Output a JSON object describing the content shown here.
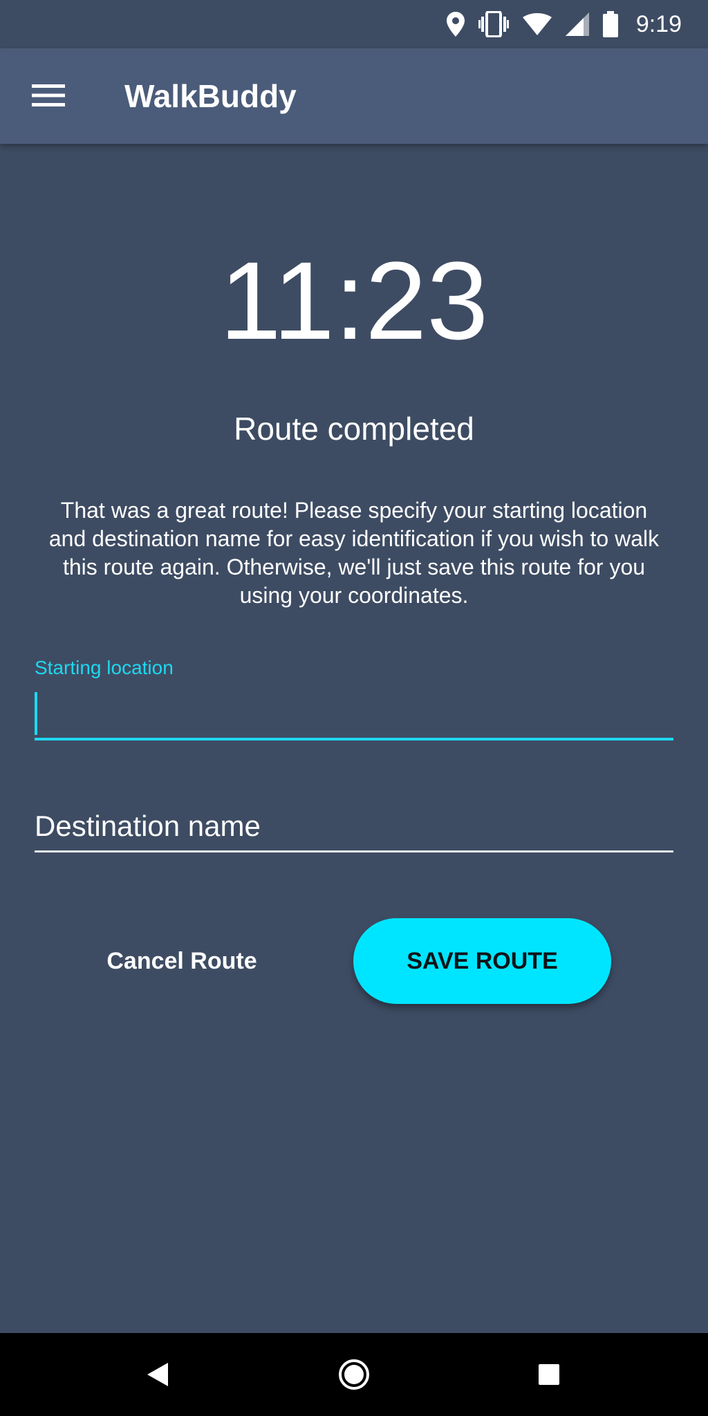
{
  "status_bar": {
    "time": "9:19",
    "icons": [
      "location-icon",
      "vibrate-icon",
      "wifi-icon",
      "signal-icon",
      "battery-icon"
    ]
  },
  "app_bar": {
    "title": "WalkBuddy",
    "menu_icon": "hamburger-menu-icon"
  },
  "main": {
    "elapsed_time": "11:23",
    "heading": "Route completed",
    "description": "That was a great route! Please specify your starting location and destination name for easy identification if you wish to walk this route again. Otherwise, we'll just save this route for you using your coordinates."
  },
  "form": {
    "starting_location": {
      "label": "Starting location",
      "value": ""
    },
    "destination": {
      "placeholder": "Destination name",
      "value": ""
    }
  },
  "actions": {
    "cancel_label": "Cancel Route",
    "save_label": "SAVE ROUTE"
  },
  "nav_bar": {
    "icons": [
      "back-icon",
      "home-icon",
      "recents-icon"
    ]
  },
  "colors": {
    "background": "#3e4c63",
    "app_bar": "#4b5c7a",
    "accent": "#00e5ff",
    "focus_line": "#1ed8f0"
  }
}
